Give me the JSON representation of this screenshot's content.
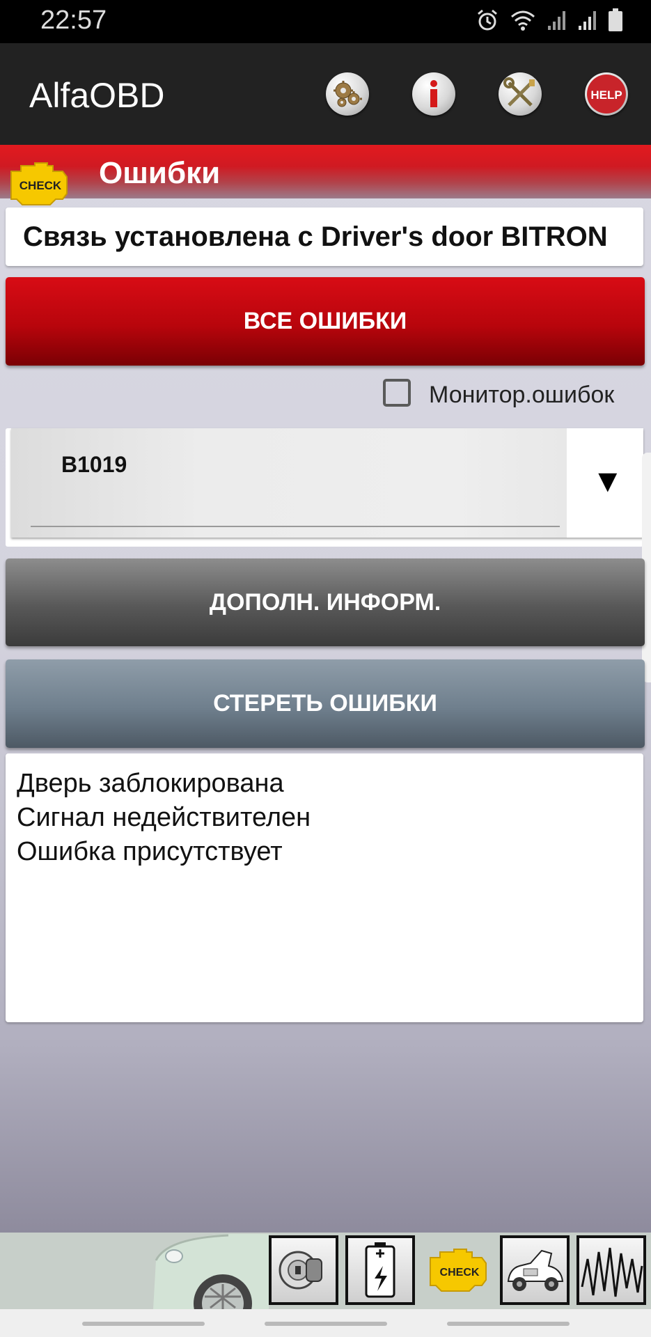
{
  "status_bar": {
    "time": "22:57",
    "icons": [
      "alarm-icon",
      "wifi-icon",
      "signal-icon",
      "signal-icon",
      "battery-icon"
    ]
  },
  "app_bar": {
    "title": "AlfaOBD",
    "actions": [
      {
        "name": "settings-gears-icon"
      },
      {
        "name": "info-icon",
        "glyph": "i"
      },
      {
        "name": "tools-icon"
      },
      {
        "name": "help-icon",
        "text": "HELP"
      }
    ]
  },
  "section": {
    "title": "Ошибки",
    "badge_text": "CHECK"
  },
  "connection": {
    "text": "Связь установлена с Driver's door BITRON"
  },
  "buttons": {
    "all_errors": "ВСЕ ОШИБКИ",
    "more_info": "ДОПОЛН. ИНФОРМ.",
    "clear_errors": "СТЕРЕТЬ ОШИБКИ"
  },
  "monitor": {
    "label": "Монитор.ошибок",
    "checked": false
  },
  "error_select": {
    "selected": "B1019",
    "arrow": "▼"
  },
  "details": {
    "lines": [
      "Дверь заблокирована",
      "Сигнал недействителен",
      "Ошибка присутствует"
    ]
  },
  "bottom_toolbar": {
    "items": [
      {
        "name": "ignition-key-icon"
      },
      {
        "name": "battery-charge-icon"
      },
      {
        "name": "check-engine-icon",
        "text": "CHECK"
      },
      {
        "name": "car-hood-open-icon"
      },
      {
        "name": "waveform-icon"
      }
    ]
  },
  "colors": {
    "section_red": "#e21a1f",
    "button_red": "#b8050c",
    "button_gray": "#585858",
    "button_slate": "#6f7f8d",
    "check_yellow": "#f6c800"
  }
}
